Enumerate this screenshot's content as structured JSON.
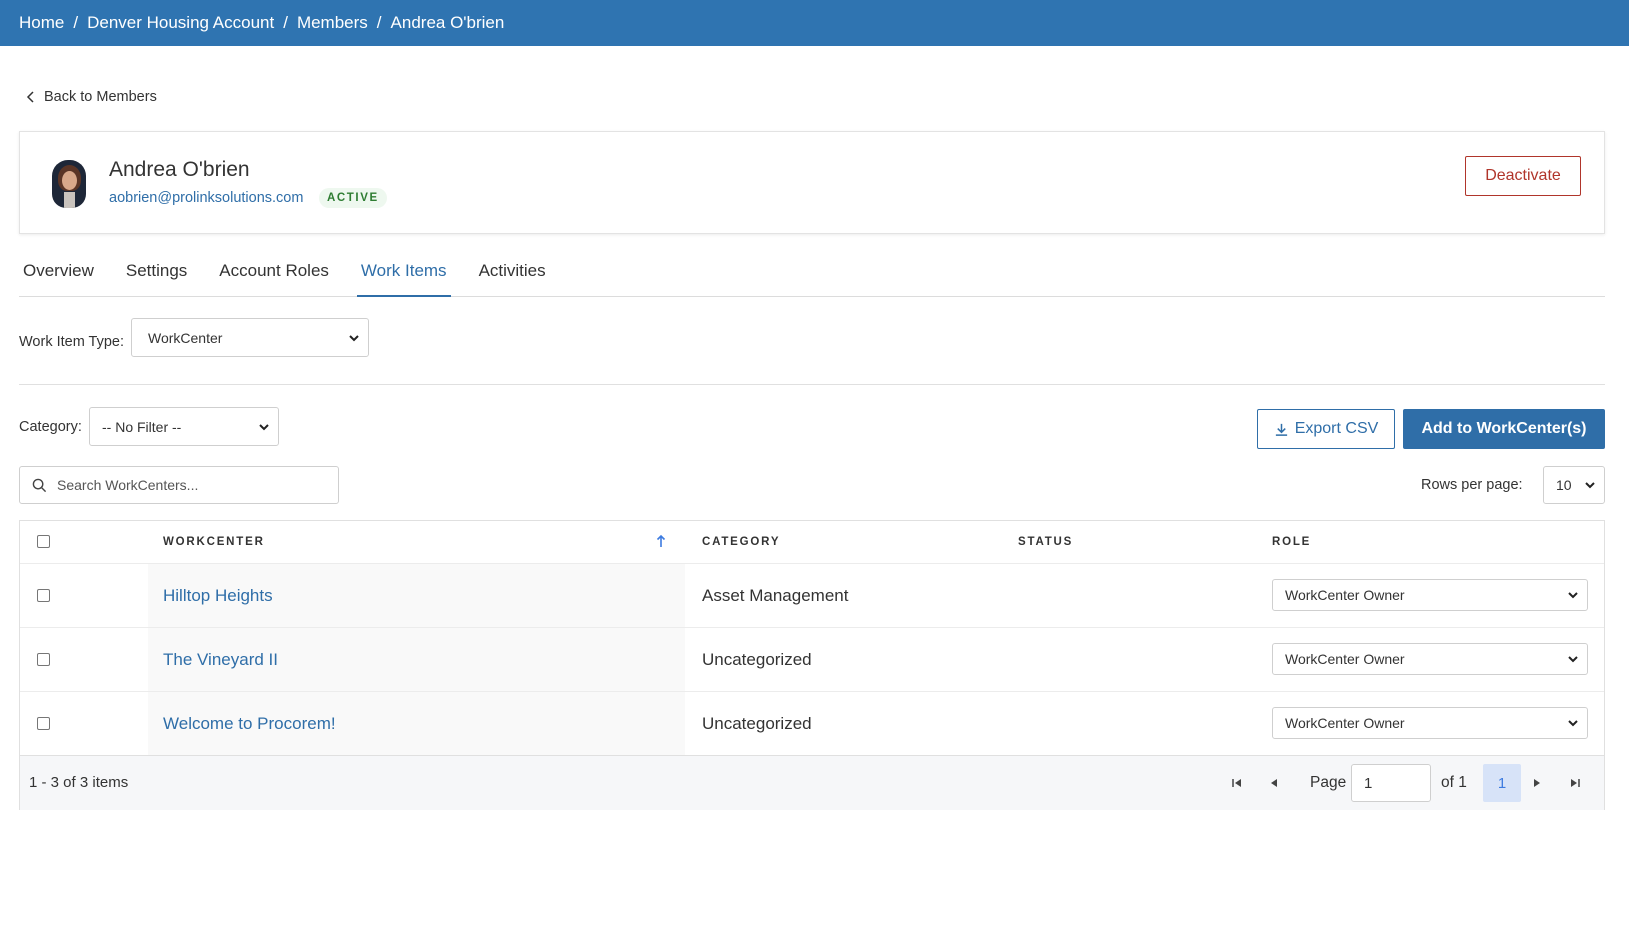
{
  "breadcrumb": [
    {
      "label": "Home"
    },
    {
      "label": "Denver Housing Account"
    },
    {
      "label": "Members"
    },
    {
      "label": "Andrea O'brien"
    }
  ],
  "back_link": "Back to Members",
  "member": {
    "name": "Andrea O'brien",
    "email": "aobrien@prolinksolutions.com",
    "status": "ACTIVE",
    "deactivate_label": "Deactivate"
  },
  "tabs": [
    {
      "label": "Overview",
      "active": false
    },
    {
      "label": "Settings",
      "active": false
    },
    {
      "label": "Account Roles",
      "active": false
    },
    {
      "label": "Work Items",
      "active": true
    },
    {
      "label": "Activities",
      "active": false
    }
  ],
  "filters": {
    "work_item_type_label": "Work Item Type:",
    "work_item_type_value": "WorkCenter",
    "category_label": "Category:",
    "category_value": "-- No Filter --"
  },
  "actions": {
    "export_label": "Export CSV",
    "add_label": "Add to WorkCenter(s)"
  },
  "search": {
    "placeholder": "Search WorkCenters..."
  },
  "rows_per_page": {
    "label": "Rows per page:",
    "value": "10"
  },
  "table": {
    "columns": {
      "workcenter": "WORKCENTER",
      "category": "CATEGORY",
      "status": "STATUS",
      "role": "ROLE"
    },
    "sort_icon": "arrow-up-icon",
    "rows": [
      {
        "workcenter": "Hilltop Heights",
        "category": "Asset Management",
        "status": "",
        "role": "WorkCenter Owner"
      },
      {
        "workcenter": "The Vineyard II",
        "category": "Uncategorized",
        "status": "",
        "role": "WorkCenter Owner"
      },
      {
        "workcenter": "Welcome to Procorem!",
        "category": "Uncategorized",
        "status": "",
        "role": "WorkCenter Owner"
      }
    ]
  },
  "pagination": {
    "summary": "1 - 3 of 3 items",
    "page_label": "Page",
    "page_value": "1",
    "of_label": "of 1",
    "current_page": "1"
  },
  "colors": {
    "brand": "#2f74b1",
    "link": "#2f6ea8",
    "danger": "#b0352b",
    "success": "#2e7d32"
  }
}
